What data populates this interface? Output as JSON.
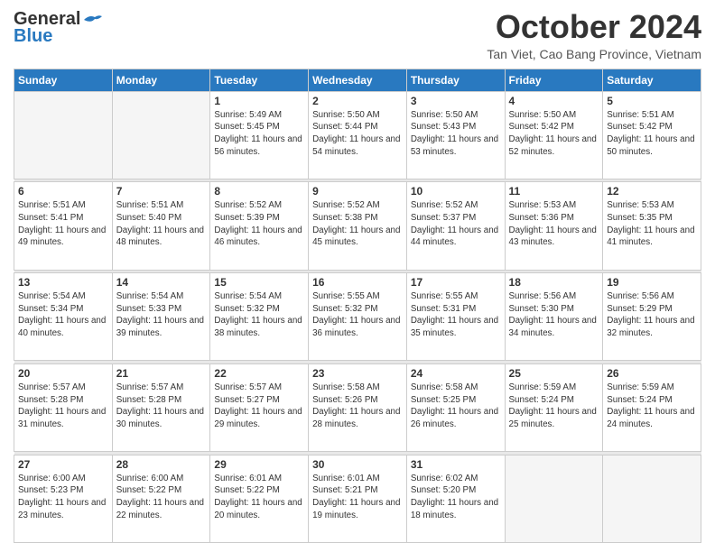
{
  "header": {
    "logo": {
      "general": "General",
      "blue": "Blue"
    },
    "title": "October 2024",
    "location": "Tan Viet, Cao Bang Province, Vietnam"
  },
  "weekdays": [
    "Sunday",
    "Monday",
    "Tuesday",
    "Wednesday",
    "Thursday",
    "Friday",
    "Saturday"
  ],
  "weeks": [
    [
      {
        "day": "",
        "empty": true
      },
      {
        "day": "",
        "empty": true
      },
      {
        "day": "1",
        "sunrise": "5:49 AM",
        "sunset": "5:45 PM",
        "daylight": "11 hours and 56 minutes."
      },
      {
        "day": "2",
        "sunrise": "5:50 AM",
        "sunset": "5:44 PM",
        "daylight": "11 hours and 54 minutes."
      },
      {
        "day": "3",
        "sunrise": "5:50 AM",
        "sunset": "5:43 PM",
        "daylight": "11 hours and 53 minutes."
      },
      {
        "day": "4",
        "sunrise": "5:50 AM",
        "sunset": "5:42 PM",
        "daylight": "11 hours and 52 minutes."
      },
      {
        "day": "5",
        "sunrise": "5:51 AM",
        "sunset": "5:42 PM",
        "daylight": "11 hours and 50 minutes."
      }
    ],
    [
      {
        "day": "6",
        "sunrise": "5:51 AM",
        "sunset": "5:41 PM",
        "daylight": "11 hours and 49 minutes."
      },
      {
        "day": "7",
        "sunrise": "5:51 AM",
        "sunset": "5:40 PM",
        "daylight": "11 hours and 48 minutes."
      },
      {
        "day": "8",
        "sunrise": "5:52 AM",
        "sunset": "5:39 PM",
        "daylight": "11 hours and 46 minutes."
      },
      {
        "day": "9",
        "sunrise": "5:52 AM",
        "sunset": "5:38 PM",
        "daylight": "11 hours and 45 minutes."
      },
      {
        "day": "10",
        "sunrise": "5:52 AM",
        "sunset": "5:37 PM",
        "daylight": "11 hours and 44 minutes."
      },
      {
        "day": "11",
        "sunrise": "5:53 AM",
        "sunset": "5:36 PM",
        "daylight": "11 hours and 43 minutes."
      },
      {
        "day": "12",
        "sunrise": "5:53 AM",
        "sunset": "5:35 PM",
        "daylight": "11 hours and 41 minutes."
      }
    ],
    [
      {
        "day": "13",
        "sunrise": "5:54 AM",
        "sunset": "5:34 PM",
        "daylight": "11 hours and 40 minutes."
      },
      {
        "day": "14",
        "sunrise": "5:54 AM",
        "sunset": "5:33 PM",
        "daylight": "11 hours and 39 minutes."
      },
      {
        "day": "15",
        "sunrise": "5:54 AM",
        "sunset": "5:32 PM",
        "daylight": "11 hours and 38 minutes."
      },
      {
        "day": "16",
        "sunrise": "5:55 AM",
        "sunset": "5:32 PM",
        "daylight": "11 hours and 36 minutes."
      },
      {
        "day": "17",
        "sunrise": "5:55 AM",
        "sunset": "5:31 PM",
        "daylight": "11 hours and 35 minutes."
      },
      {
        "day": "18",
        "sunrise": "5:56 AM",
        "sunset": "5:30 PM",
        "daylight": "11 hours and 34 minutes."
      },
      {
        "day": "19",
        "sunrise": "5:56 AM",
        "sunset": "5:29 PM",
        "daylight": "11 hours and 32 minutes."
      }
    ],
    [
      {
        "day": "20",
        "sunrise": "5:57 AM",
        "sunset": "5:28 PM",
        "daylight": "11 hours and 31 minutes."
      },
      {
        "day": "21",
        "sunrise": "5:57 AM",
        "sunset": "5:28 PM",
        "daylight": "11 hours and 30 minutes."
      },
      {
        "day": "22",
        "sunrise": "5:57 AM",
        "sunset": "5:27 PM",
        "daylight": "11 hours and 29 minutes."
      },
      {
        "day": "23",
        "sunrise": "5:58 AM",
        "sunset": "5:26 PM",
        "daylight": "11 hours and 28 minutes."
      },
      {
        "day": "24",
        "sunrise": "5:58 AM",
        "sunset": "5:25 PM",
        "daylight": "11 hours and 26 minutes."
      },
      {
        "day": "25",
        "sunrise": "5:59 AM",
        "sunset": "5:24 PM",
        "daylight": "11 hours and 25 minutes."
      },
      {
        "day": "26",
        "sunrise": "5:59 AM",
        "sunset": "5:24 PM",
        "daylight": "11 hours and 24 minutes."
      }
    ],
    [
      {
        "day": "27",
        "sunrise": "6:00 AM",
        "sunset": "5:23 PM",
        "daylight": "11 hours and 23 minutes."
      },
      {
        "day": "28",
        "sunrise": "6:00 AM",
        "sunset": "5:22 PM",
        "daylight": "11 hours and 22 minutes."
      },
      {
        "day": "29",
        "sunrise": "6:01 AM",
        "sunset": "5:22 PM",
        "daylight": "11 hours and 20 minutes."
      },
      {
        "day": "30",
        "sunrise": "6:01 AM",
        "sunset": "5:21 PM",
        "daylight": "11 hours and 19 minutes."
      },
      {
        "day": "31",
        "sunrise": "6:02 AM",
        "sunset": "5:20 PM",
        "daylight": "11 hours and 18 minutes."
      },
      {
        "day": "",
        "empty": true
      },
      {
        "day": "",
        "empty": true
      }
    ]
  ],
  "labels": {
    "sunrise": "Sunrise:",
    "sunset": "Sunset:",
    "daylight": "Daylight:"
  }
}
